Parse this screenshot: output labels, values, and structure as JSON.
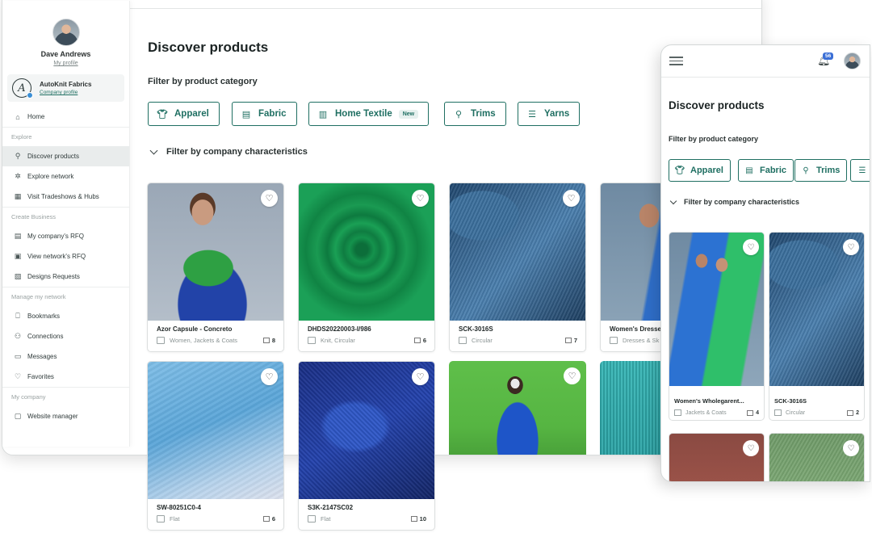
{
  "sidebar": {
    "user_name": "Dave Andrews",
    "user_link": "My profile",
    "company_name": "AutoKnit Fabrics",
    "company_link": "Company profile",
    "items": [
      {
        "label": "Home",
        "icon": "home-icon"
      },
      {
        "section": "Explore"
      },
      {
        "label": "Discover products",
        "icon": "discover-icon",
        "active": true
      },
      {
        "label": "Explore network",
        "icon": "network-icon"
      },
      {
        "label": "Visit Tradeshows & Hubs",
        "icon": "calendar-icon"
      },
      {
        "section": "Create Business"
      },
      {
        "label": "My company's RFQ",
        "icon": "document-icon"
      },
      {
        "label": "View network's RFQ",
        "icon": "document-view-icon"
      },
      {
        "label": "Designs Requests",
        "icon": "design-icon"
      },
      {
        "section": "Manage my network"
      },
      {
        "label": "Bookmarks",
        "icon": "bookmark-icon"
      },
      {
        "label": "Connections",
        "icon": "connections-icon"
      },
      {
        "label": "Messages",
        "icon": "messages-icon"
      },
      {
        "label": "Favorites",
        "icon": "heart-icon"
      },
      {
        "section": "My company"
      },
      {
        "label": "Website manager",
        "icon": "website-icon"
      }
    ]
  },
  "main": {
    "title": "Discover products",
    "filter_label": "Filter by product category",
    "company_filter_label": "Filter by company characteristics",
    "categories": [
      {
        "label": "Apparel",
        "icon": "shirt-icon"
      },
      {
        "label": "Fabric",
        "icon": "fabric-icon"
      },
      {
        "label": "Home Textile",
        "icon": "home-textile-icon",
        "badge": "New"
      },
      {
        "label": "Trims",
        "icon": "zipper-icon"
      },
      {
        "label": "Yarns",
        "icon": "yarn-icon"
      }
    ],
    "products": [
      {
        "title": "Azor Capsule - Concreto",
        "category": "Women, Jackets & Coats",
        "count": "8"
      },
      {
        "title": "DHDS20220003-I/986",
        "category": "Knit, Circular",
        "count": "6"
      },
      {
        "title": "SCK-3016S",
        "category": "Circular",
        "count": "7"
      },
      {
        "title": "Women's Dresses",
        "category": "Dresses & Sk",
        "count": ""
      },
      {
        "title": "SW-80251C0-4",
        "category": "Flat",
        "count": "6"
      },
      {
        "title": "S3K-2147SC02",
        "category": "Flat",
        "count": "10"
      },
      {
        "title": "",
        "category": "",
        "count": ""
      },
      {
        "title": "",
        "category": "",
        "count": ""
      }
    ]
  },
  "mobile": {
    "notification_count": "56",
    "title": "Discover products",
    "filter_label": "Filter by product category",
    "company_filter_label": "Filter by company characteristics",
    "categories": [
      {
        "label": "Apparel",
        "icon": "shirt-icon"
      },
      {
        "label": "Fabric",
        "icon": "fabric-icon"
      },
      {
        "label": "Trims",
        "icon": "zipper-icon"
      }
    ],
    "products": [
      {
        "title": "Women's Wholegarent...",
        "category": "Jackets & Coats",
        "count": "4"
      },
      {
        "title": "SCK-3016S",
        "category": "Circular",
        "count": "2"
      }
    ]
  },
  "colors": {
    "accent": "#1f6f62",
    "active_nav_bg": "#e9ecec",
    "notification_badge": "#3b6fd6"
  }
}
